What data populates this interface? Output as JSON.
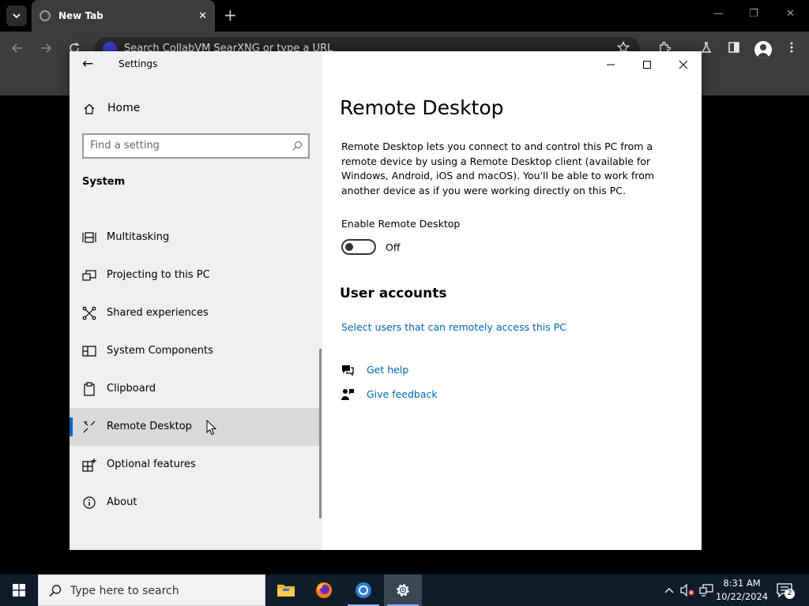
{
  "browser": {
    "tab_title": "New Tab",
    "tab_close": "✕",
    "new_tab": "+",
    "omnibox_placeholder": "Search CollabVM SearXNG or type a URL",
    "window_minimize": "—",
    "window_restore": "❐",
    "window_close": "✕"
  },
  "window": {
    "title": "Settings",
    "back_label": "←"
  },
  "sidebar": {
    "home_label": "Home",
    "search_placeholder": "Find a setting",
    "section_label": "System",
    "items": [
      {
        "label": "Multitasking",
        "icon": "multitasking-icon"
      },
      {
        "label": "Projecting to this PC",
        "icon": "projecting-icon"
      },
      {
        "label": "Shared experiences",
        "icon": "shared-experiences-icon"
      },
      {
        "label": "System Components",
        "icon": "system-components-icon"
      },
      {
        "label": "Clipboard",
        "icon": "clipboard-icon"
      },
      {
        "label": "Remote Desktop",
        "icon": "remote-desktop-icon",
        "selected": true
      },
      {
        "label": "Optional features",
        "icon": "optional-features-icon"
      },
      {
        "label": "About",
        "icon": "info-icon"
      }
    ]
  },
  "main": {
    "title": "Remote Desktop",
    "description": "Remote Desktop lets you connect to and control this PC from a remote device by using a Remote Desktop client (available for Windows, Android, iOS and macOS). You'll be able to work from another device as if you were working directly on this PC.",
    "toggle_heading": "Enable Remote Desktop",
    "toggle_state": "Off",
    "user_accounts_heading": "User accounts",
    "select_users_link": "Select users that can remotely access this PC",
    "get_help_link": "Get help",
    "give_feedback_link": "Give feedback"
  },
  "taskbar": {
    "search_placeholder": "Type here to search",
    "time": "8:31 AM",
    "date": "10/22/2024",
    "notification_count": "2"
  },
  "colors": {
    "accent": "#0067c0",
    "link": "#0066b4",
    "sidebar_bg": "#f0f0f0",
    "taskbar_bg": "#101c2a"
  }
}
